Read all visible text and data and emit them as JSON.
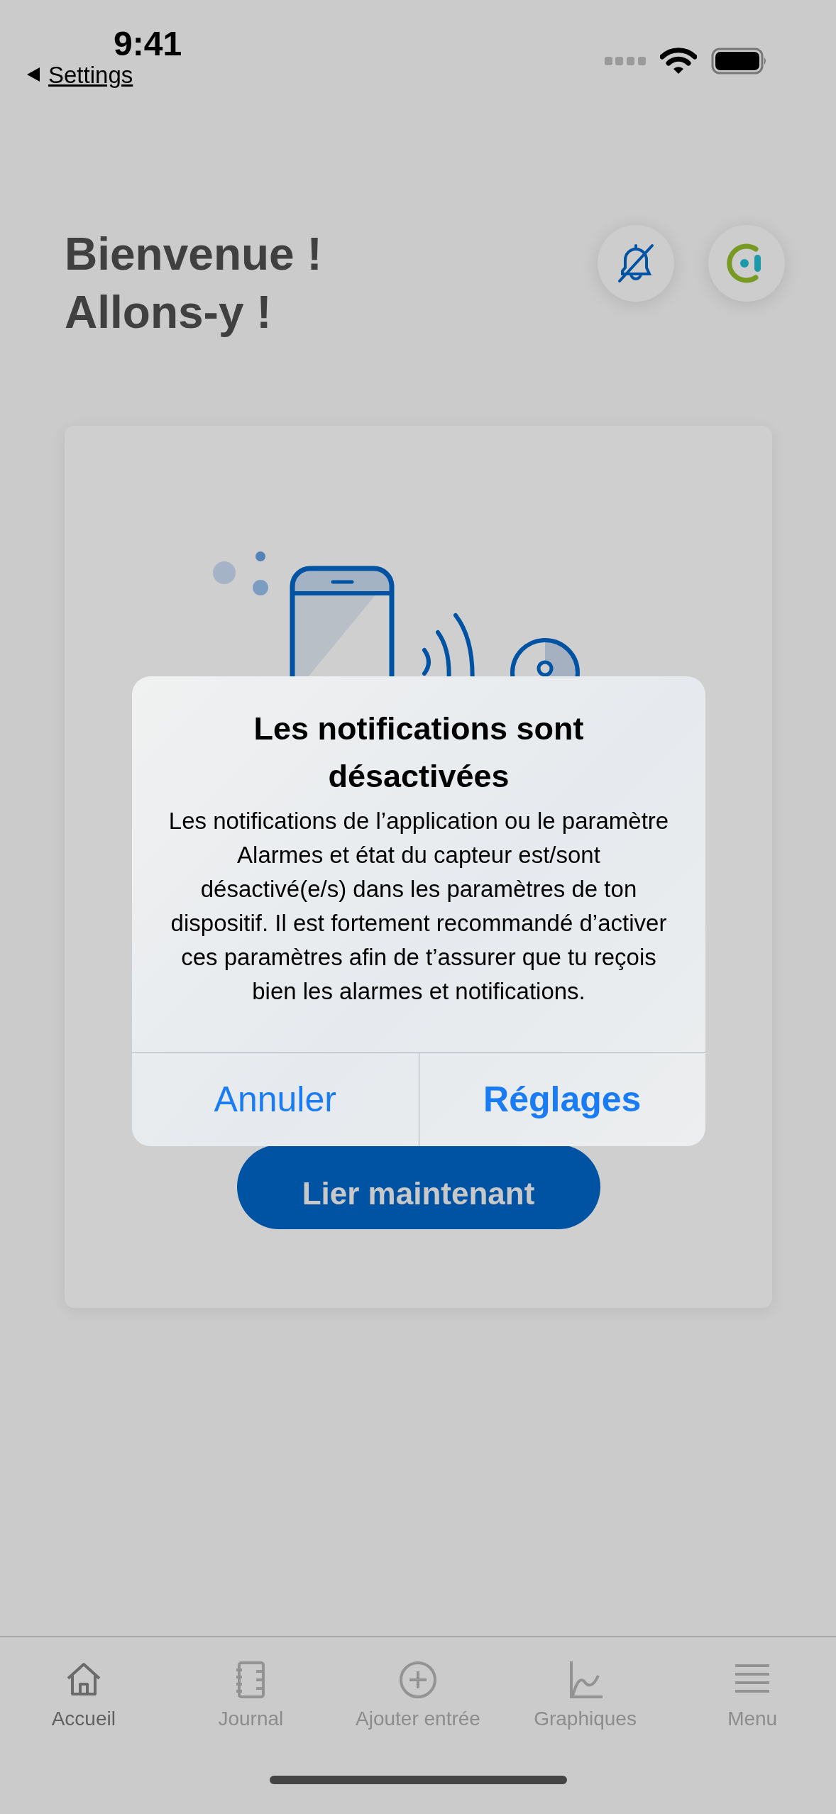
{
  "status_bar": {
    "time": "9:41",
    "back_label": "Settings"
  },
  "header": {
    "title_lines": [
      "Bienvenue !",
      "Allons-y !"
    ]
  },
  "card": {
    "button": "Lier maintenant"
  },
  "alert": {
    "title": "Les notifications sont désactivées",
    "message": "Les notifications de l’application ou le paramètre Alarmes et état du capteur est/sont désactivé(e/s) dans les paramètres de ton dispositif. Il est fortement recommandé d’activer ces paramètres afin de t’assurer que tu reçois bien les alarmes et notifications.",
    "buttons": [
      {
        "label": "Annuler",
        "kind": "cancel"
      },
      {
        "label": "Réglages",
        "kind": "default"
      }
    ]
  },
  "tab_bar": {
    "items": [
      {
        "label": "Accueil",
        "selected": true
      },
      {
        "label": "Journal",
        "selected": false
      },
      {
        "label": "Ajouter entrée",
        "selected": false
      },
      {
        "label": "Graphiques",
        "selected": false
      },
      {
        "label": "Menu",
        "selected": false
      }
    ]
  }
}
